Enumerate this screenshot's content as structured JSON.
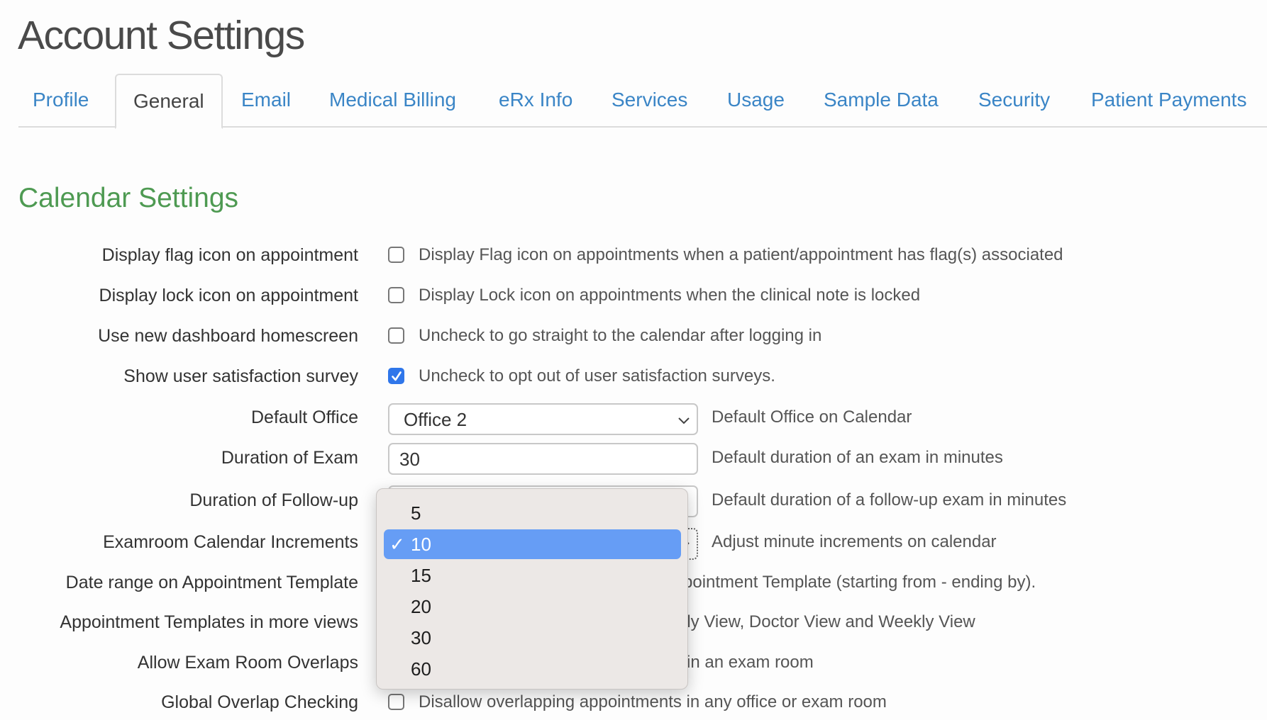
{
  "page": {
    "title": "Account Settings"
  },
  "tabs": [
    {
      "label": "Profile",
      "active": false
    },
    {
      "label": "General",
      "active": true
    },
    {
      "label": "Email",
      "active": false
    },
    {
      "label": "Medical Billing",
      "active": false
    },
    {
      "label": "eRx Info",
      "active": false
    },
    {
      "label": "Services",
      "active": false
    },
    {
      "label": "Usage",
      "active": false
    },
    {
      "label": "Sample Data",
      "active": false
    },
    {
      "label": "Security",
      "active": false
    },
    {
      "label": "Patient Payments",
      "active": false
    }
  ],
  "section": {
    "title": "Calendar Settings"
  },
  "settings": {
    "flag_icon": {
      "label": "Display flag icon on appointment",
      "checked": false,
      "description": "Display Flag icon on appointments when a patient/appointment has flag(s) associated"
    },
    "lock_icon": {
      "label": "Display lock icon on appointment",
      "checked": false,
      "description": "Display Lock icon on appointments when the clinical note is locked"
    },
    "dashboard": {
      "label": "Use new dashboard homescreen",
      "checked": false,
      "description": "Uncheck to go straight to the calendar after logging in"
    },
    "survey": {
      "label": "Show user satisfaction survey",
      "checked": true,
      "description": "Uncheck to opt out of user satisfaction surveys."
    },
    "default_office": {
      "label": "Default Office",
      "value": "Office 2",
      "description": "Default Office on Calendar"
    },
    "exam_duration": {
      "label": "Duration of Exam",
      "value": "30",
      "description": "Default duration of an exam in minutes"
    },
    "followup_duration": {
      "label": "Duration of Follow-up",
      "value": "",
      "description": "Default duration of a follow-up exam in minutes"
    },
    "increments": {
      "label": "Examroom Calendar Increments",
      "value": "10",
      "description": "Adjust minute increments on calendar"
    },
    "date_range": {
      "label": "Date range on Appointment Template",
      "description_visible": "pointment Template (starting from - ending by)."
    },
    "templates_views": {
      "label": "Appointment Templates in more views",
      "description_visible": "ily View, Doctor View and Weekly View"
    },
    "room_overlaps": {
      "label": "Allow Exam Room Overlaps",
      "description_visible": "in an exam room"
    },
    "global_overlap": {
      "label": "Global Overlap Checking",
      "checked": false,
      "description": "Disallow overlapping appointments in any office or exam room"
    }
  },
  "increments_dropdown": {
    "options": [
      "5",
      "10",
      "15",
      "20",
      "30",
      "60"
    ],
    "selected": "10",
    "check_glyph": "✓"
  },
  "colors": {
    "tab_link": "#3a85c6",
    "section_heading": "#4e9a52",
    "checkbox_checked": "#2f76ea",
    "menu_selected": "#669df5",
    "menu_bg": "#ece8e6"
  }
}
